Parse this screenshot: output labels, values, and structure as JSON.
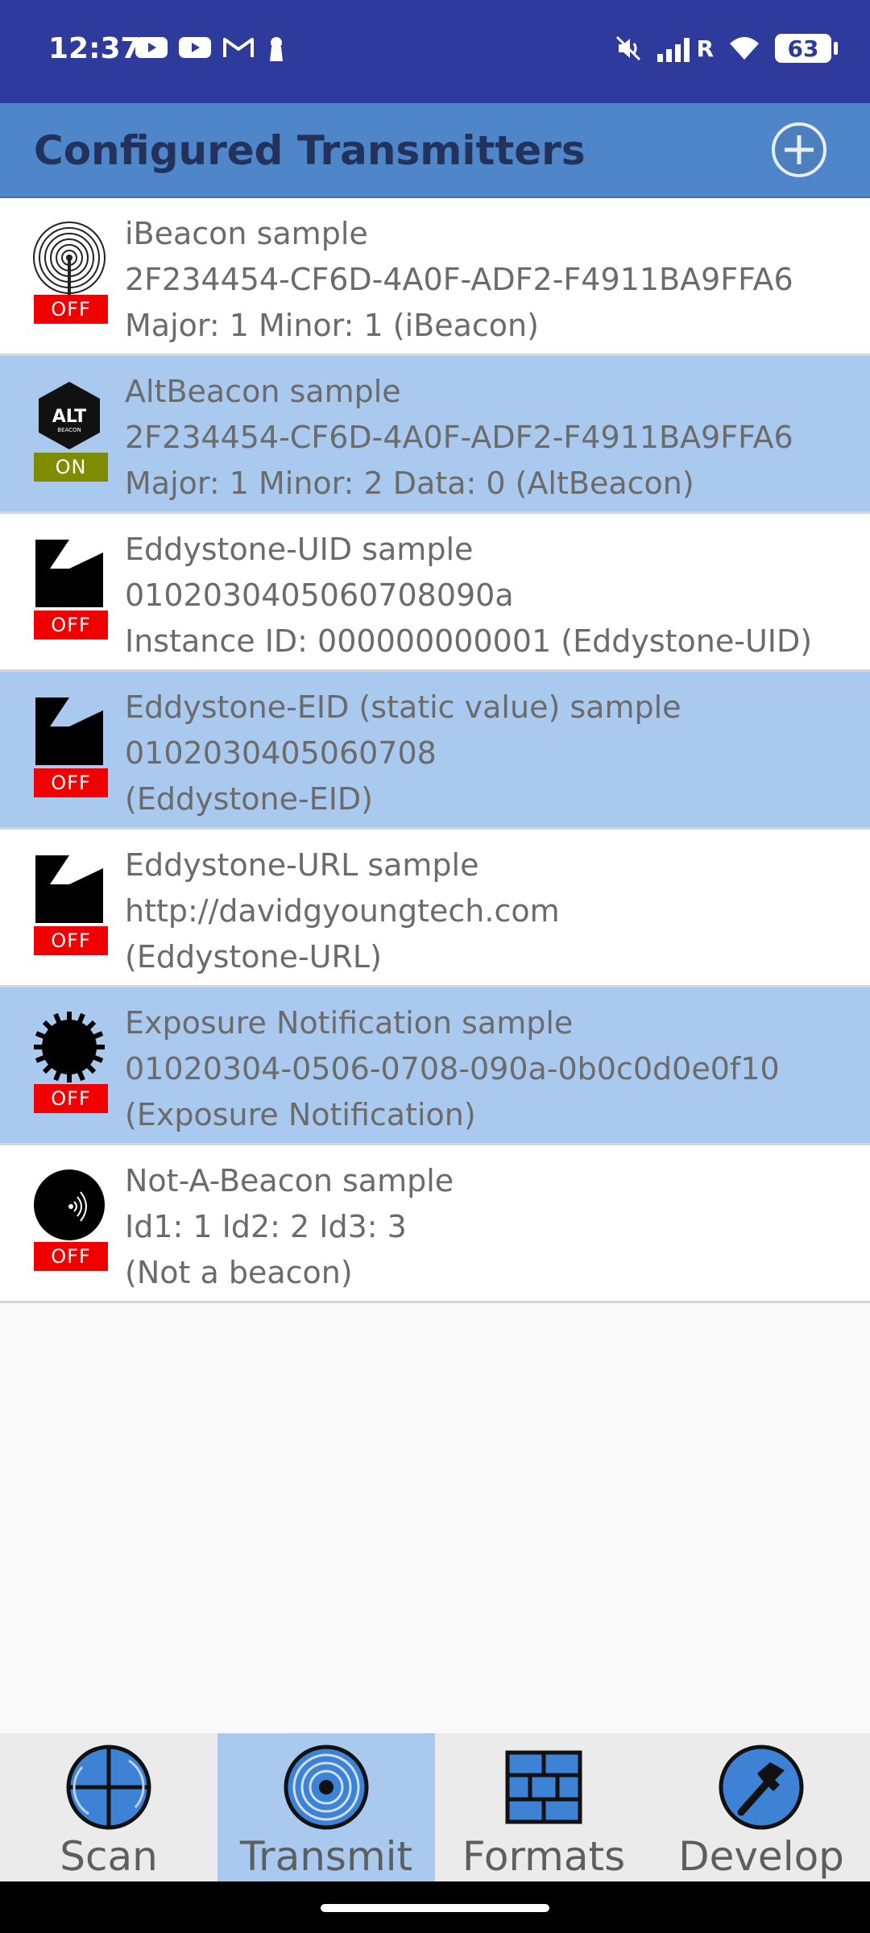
{
  "status_bar": {
    "time": "12:37",
    "battery": "63",
    "network_label": "R",
    "left_icons": [
      "youtube-icon",
      "youtube-icon",
      "gmail-icon",
      "keyhole-icon"
    ],
    "right_icons": [
      "mute-icon",
      "signal-icon",
      "wifi-icon",
      "battery-icon"
    ]
  },
  "app_bar": {
    "title": "Configured Transmitters",
    "add_icon": "plus-circle-icon"
  },
  "transmitters": [
    {
      "name": "iBeacon sample",
      "id": "2F234454-CF6D-4A0F-ADF2-F4911BA9FFA6",
      "detail": "Major: 1  Minor: 1 (iBeacon)",
      "status": "OFF",
      "icon": "ibeacon-icon"
    },
    {
      "name": "AltBeacon sample",
      "id": "2F234454-CF6D-4A0F-ADF2-F4911BA9FFA6",
      "detail": "Major: 1  Minor: 2  Data: 0 (AltBeacon)",
      "status": "ON",
      "icon": "altbeacon-icon",
      "icon_text": "ALT",
      "icon_subtext": "BEACON"
    },
    {
      "name": "Eddystone-UID sample",
      "id": "0102030405060708090a",
      "detail": "Instance ID: 000000000001 (Eddystone-UID)",
      "status": "OFF",
      "icon": "eddystone-icon"
    },
    {
      "name": "Eddystone-EID (static value) sample",
      "id": "0102030405060708",
      "detail": "(Eddystone-EID)",
      "status": "OFF",
      "icon": "eddystone-icon"
    },
    {
      "name": "Eddystone-URL sample",
      "id": "http://davidgyoungtech.com",
      "detail": "(Eddystone-URL)",
      "status": "OFF",
      "icon": "eddystone-icon"
    },
    {
      "name": "Exposure Notification sample",
      "id": "01020304-0506-0708-090a-0b0c0d0e0f10",
      "detail": "(Exposure Notification)",
      "status": "OFF",
      "icon": "virus-icon"
    },
    {
      "name": "Not-A-Beacon sample",
      "id": "Id1: 1 Id2: 2  Id3: 3",
      "detail": "(Not a beacon)",
      "status": "OFF",
      "icon": "not-a-beacon-icon"
    }
  ],
  "bottom_nav": [
    {
      "label": "Scan",
      "icon": "scan-crosshair-icon",
      "active": false
    },
    {
      "label": "Transmit",
      "icon": "transmit-rings-icon",
      "active": true
    },
    {
      "label": "Formats",
      "icon": "formats-grid-icon",
      "active": false
    },
    {
      "label": "Develop",
      "icon": "hammer-icon",
      "active": false
    }
  ],
  "colors": {
    "status_bar": "#2e3a9c",
    "app_bar": "#4e86c9",
    "title_text": "#22325a",
    "row_highlight": "#a9c9ee",
    "off_badge": "#f00000",
    "on_badge": "#7f8c00",
    "nav_active": "#a9c9ee"
  }
}
